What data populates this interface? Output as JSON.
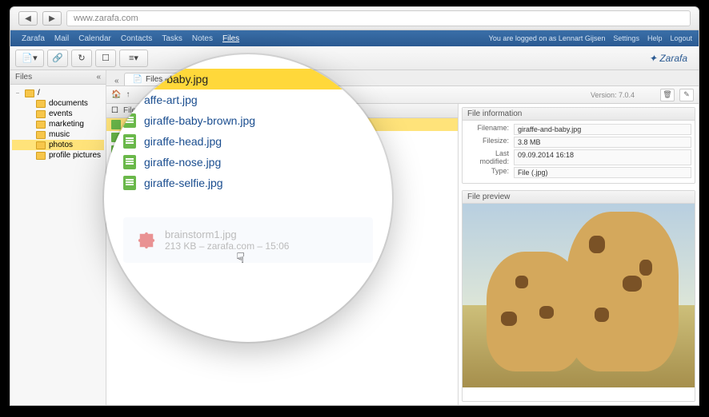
{
  "browser": {
    "url": "www.zarafa.com"
  },
  "top_menu": {
    "items": [
      "Zarafa",
      "Mail",
      "Calendar",
      "Contacts",
      "Tasks",
      "Notes",
      "Files"
    ],
    "active": "Files",
    "logged_in_text": "You are logged on as Lennart Gijsen",
    "settings": "Settings",
    "help": "Help",
    "logout": "Logout"
  },
  "brand": "Zarafa",
  "sidebar": {
    "title": "Files",
    "root": "/",
    "items": [
      {
        "label": "documents",
        "indent": 1,
        "sel": false
      },
      {
        "label": "events",
        "indent": 1,
        "sel": false
      },
      {
        "label": "marketing",
        "indent": 1,
        "sel": false
      },
      {
        "label": "music",
        "indent": 1,
        "sel": false
      },
      {
        "label": "photos",
        "indent": 1,
        "sel": true
      },
      {
        "label": "profile pictures",
        "indent": 1,
        "sel": false
      }
    ]
  },
  "tab": {
    "label": "Files - Files"
  },
  "main_toolbar": {
    "version": "Version: 7.0.4"
  },
  "list": {
    "header_col": "Filename",
    "rows": [
      {
        "label": "giraffe-and-baby.jpg",
        "sel": true
      },
      {
        "label": "giraffe-art.jpg",
        "sel": false
      },
      {
        "label": "giraffe-baby-brown.jpg",
        "sel": false
      },
      {
        "label": "giraffe-head.jpg",
        "sel": false
      },
      {
        "label": "giraffe-nose.jpg",
        "sel": false
      },
      {
        "label": "giraffe-selfie.jpg",
        "sel": false
      }
    ]
  },
  "detail": {
    "info_title": "File information",
    "filename_label": "Filename:",
    "filename": "giraffe-and-baby.jpg",
    "filesize_label": "Filesize:",
    "filesize": "3.8 MB",
    "modified_label": "Last modified:",
    "modified": "09.09.2014 16:18",
    "type_label": "Type:",
    "type": "File (.jpg)",
    "preview_title": "File preview"
  },
  "magnifier": {
    "rows": [
      {
        "label": "nd-baby.jpg",
        "sel": true,
        "partial": true
      },
      {
        "label": "affe-art.jpg",
        "sel": false,
        "partial": true
      },
      {
        "label": "giraffe-baby-brown.jpg",
        "sel": false
      },
      {
        "label": "giraffe-head.jpg",
        "sel": false
      },
      {
        "label": "giraffe-nose.jpg",
        "sel": false
      },
      {
        "label": "giraffe-selfie.jpg",
        "sel": false
      }
    ],
    "drop": {
      "filename": "brainstorm1.jpg",
      "meta": "213 KB – zarafa.com – 15:06"
    }
  }
}
